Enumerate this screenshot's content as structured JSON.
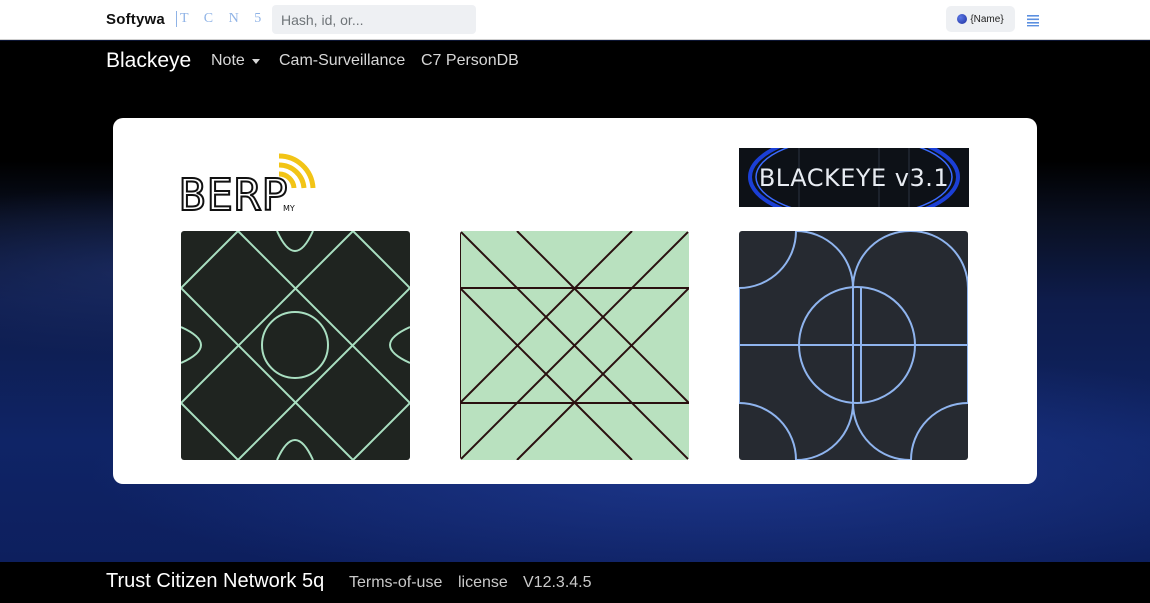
{
  "topbar": {
    "brand": "Softywa",
    "brand_tag": "T C N 5 Q",
    "search_placeholder": "Hash, id, or...",
    "user_label": "{Name}"
  },
  "nav": {
    "brand": "Blackeye",
    "items": [
      {
        "label": "Note",
        "has_dropdown": true
      },
      {
        "label": "Cam-Surveillance"
      },
      {
        "label": "C7 PersonDB"
      }
    ]
  },
  "card": {
    "logo_text": "BERP",
    "logo_sub": "MY",
    "banner_text": "BLACKEYE v3.1",
    "tiles": [
      {
        "pattern": "grid-circle",
        "bg": "#1f2420",
        "stroke": "#a9dfc1"
      },
      {
        "pattern": "diagonal-lines",
        "bg": "#b9e1bf",
        "stroke": "#2a1010"
      },
      {
        "pattern": "arcs-circle",
        "bg": "#262a31",
        "stroke": "#8fb4ee"
      }
    ]
  },
  "footer": {
    "brand": "Trust Citizen Network 5q",
    "links": [
      "Terms-of-use",
      "license"
    ],
    "version": "V12.3.4.5"
  },
  "colors": {
    "accent": "#8fb3e6",
    "menu_icon": "#5b8fe0",
    "logo_signal": "#f2c416"
  }
}
